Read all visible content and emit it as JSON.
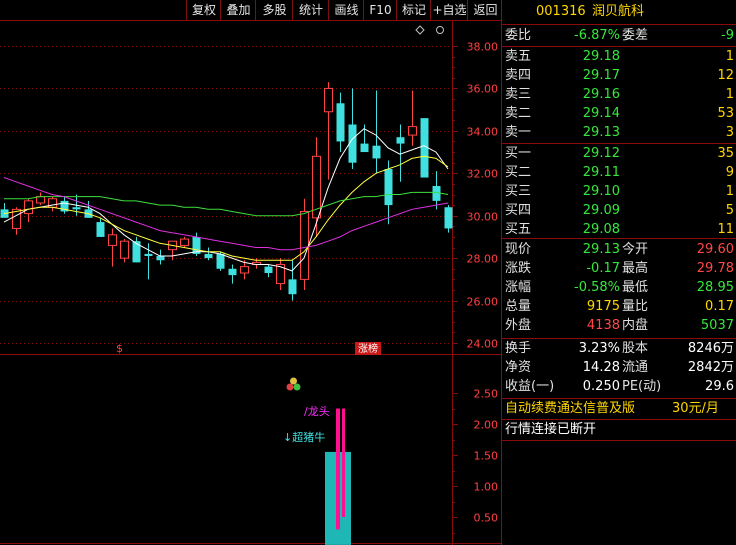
{
  "toolbar": {
    "items": [
      "复权",
      "叠加",
      "多股",
      "统计",
      "画线",
      "F10",
      "标记",
      "+自选",
      "返回"
    ]
  },
  "stock": {
    "code": "001316",
    "name": "润贝航科"
  },
  "order_book": {
    "weibi_label": "委比",
    "weibi_value": "-6.87%",
    "weicha_label": "委差",
    "weicha_value": "-9",
    "sells": [
      {
        "label": "卖五",
        "price": "29.18",
        "vol": "1"
      },
      {
        "label": "卖四",
        "price": "29.17",
        "vol": "12"
      },
      {
        "label": "卖三",
        "price": "29.16",
        "vol": "1"
      },
      {
        "label": "卖二",
        "price": "29.14",
        "vol": "53"
      },
      {
        "label": "卖一",
        "price": "29.13",
        "vol": "3"
      }
    ],
    "buys": [
      {
        "label": "买一",
        "price": "29.12",
        "vol": "35"
      },
      {
        "label": "买二",
        "price": "29.11",
        "vol": "9"
      },
      {
        "label": "买三",
        "price": "29.10",
        "vol": "1"
      },
      {
        "label": "买四",
        "price": "29.09",
        "vol": "5"
      },
      {
        "label": "买五",
        "price": "29.08",
        "vol": "11"
      }
    ]
  },
  "quote": {
    "rows": [
      {
        "l1": "现价",
        "v1": "29.13",
        "c1": "green",
        "l2": "今开",
        "v2": "29.60",
        "c2": "red"
      },
      {
        "l1": "涨跌",
        "v1": "-0.17",
        "c1": "green",
        "l2": "最高",
        "v2": "29.78",
        "c2": "red"
      },
      {
        "l1": "涨幅",
        "v1": "-0.58%",
        "c1": "green",
        "l2": "最低",
        "v2": "28.95",
        "c2": "green"
      },
      {
        "l1": "总量",
        "v1": "9175",
        "c1": "yellow",
        "l2": "量比",
        "v2": "0.17",
        "c2": "yellow"
      },
      {
        "l1": "外盘",
        "v1": "4138",
        "c1": "red",
        "l2": "内盘",
        "v2": "5037",
        "c2": "green"
      }
    ],
    "fund_rows": [
      {
        "l1": "换手",
        "v1": "3.23%",
        "l2": "股本",
        "v2": "8246万"
      },
      {
        "l1": "净资",
        "v1": "14.28",
        "l2": "流通",
        "v2": "2842万"
      },
      {
        "l1": "收益(一)",
        "v1": "0.250",
        "l2": "PE(动)",
        "v2": "29.6"
      }
    ]
  },
  "notices": {
    "ad_text": "自动续费通达信普及版",
    "ad_price": "30元/月",
    "status": "行情连接已断开"
  },
  "chart_data": {
    "type": "candlestick",
    "price_axis": {
      "ticks": [
        "38.00",
        "36.00",
        "34.00",
        "32.00",
        "30.00",
        "28.00",
        "26.00",
        "24.00"
      ],
      "ylim": [
        24,
        39.5
      ]
    },
    "candles": [
      {
        "o": 30.3,
        "h": 30.6,
        "l": 30.0,
        "c": 29.9
      },
      {
        "o": 29.4,
        "h": 30.4,
        "l": 29.1,
        "c": 30.3
      },
      {
        "o": 30.1,
        "h": 30.8,
        "l": 29.7,
        "c": 30.7
      },
      {
        "o": 30.6,
        "h": 31.1,
        "l": 30.5,
        "c": 30.9
      },
      {
        "o": 30.4,
        "h": 30.9,
        "l": 30.2,
        "c": 30.8
      },
      {
        "o": 30.7,
        "h": 30.9,
        "l": 30.1,
        "c": 30.2
      },
      {
        "o": 30.4,
        "h": 31.0,
        "l": 30.0,
        "c": 30.3
      },
      {
        "o": 30.3,
        "h": 30.7,
        "l": 29.9,
        "c": 29.9
      },
      {
        "o": 29.7,
        "h": 29.9,
        "l": 29.0,
        "c": 29.0
      },
      {
        "o": 28.6,
        "h": 29.4,
        "l": 27.6,
        "c": 29.1
      },
      {
        "o": 28.0,
        "h": 28.9,
        "l": 27.8,
        "c": 28.8
      },
      {
        "o": 28.8,
        "h": 29.0,
        "l": 27.8,
        "c": 27.8
      },
      {
        "o": 28.2,
        "h": 28.7,
        "l": 27.0,
        "c": 28.1
      },
      {
        "o": 28.1,
        "h": 28.4,
        "l": 27.7,
        "c": 27.9
      },
      {
        "o": 28.4,
        "h": 28.8,
        "l": 27.9,
        "c": 28.8
      },
      {
        "o": 28.6,
        "h": 29.0,
        "l": 28.5,
        "c": 28.9
      },
      {
        "o": 29.0,
        "h": 29.2,
        "l": 28.1,
        "c": 28.2
      },
      {
        "o": 28.2,
        "h": 28.5,
        "l": 27.9,
        "c": 28.0
      },
      {
        "o": 28.2,
        "h": 28.3,
        "l": 27.4,
        "c": 27.5
      },
      {
        "o": 27.5,
        "h": 27.7,
        "l": 26.8,
        "c": 27.2
      },
      {
        "o": 27.3,
        "h": 27.9,
        "l": 27.0,
        "c": 27.6
      },
      {
        "o": 27.7,
        "h": 28.0,
        "l": 27.5,
        "c": 27.8
      },
      {
        "o": 27.6,
        "h": 27.7,
        "l": 27.1,
        "c": 27.3
      },
      {
        "o": 26.8,
        "h": 28.0,
        "l": 26.5,
        "c": 27.7
      },
      {
        "o": 27.0,
        "h": 27.9,
        "l": 26.0,
        "c": 26.3
      },
      {
        "o": 27.0,
        "h": 30.8,
        "l": 26.5,
        "c": 30.2
      },
      {
        "o": 29.9,
        "h": 33.7,
        "l": 29.0,
        "c": 32.8
      },
      {
        "o": 34.9,
        "h": 36.3,
        "l": 31.7,
        "c": 36.0
      },
      {
        "o": 35.3,
        "h": 35.8,
        "l": 33.0,
        "c": 33.5
      },
      {
        "o": 34.3,
        "h": 36.0,
        "l": 32.2,
        "c": 32.5
      },
      {
        "o": 33.4,
        "h": 34.3,
        "l": 33.1,
        "c": 33.0
      },
      {
        "o": 33.3,
        "h": 35.9,
        "l": 32.0,
        "c": 32.7
      },
      {
        "o": 32.2,
        "h": 32.6,
        "l": 29.6,
        "c": 30.5
      },
      {
        "o": 33.7,
        "h": 34.3,
        "l": 31.6,
        "c": 33.4
      },
      {
        "o": 33.8,
        "h": 35.9,
        "l": 33.3,
        "c": 34.2
      },
      {
        "o": 34.6,
        "h": 34.5,
        "l": 31.8,
        "c": 31.8
      },
      {
        "o": 31.4,
        "h": 32.1,
        "l": 30.3,
        "c": 30.7
      },
      {
        "o": 30.4,
        "h": 30.5,
        "l": 29.2,
        "c": 29.4
      }
    ],
    "ma_lines": [
      {
        "color": "#ffffff",
        "values": [
          29.7,
          30.0,
          30.3,
          30.4,
          30.5,
          30.6,
          30.5,
          30.4,
          30.1,
          29.6,
          29.1,
          28.7,
          28.4,
          28.1,
          28.1,
          28.2,
          28.3,
          28.3,
          28.2,
          28.0,
          27.8,
          27.7,
          27.7,
          27.6,
          27.4,
          28.0,
          29.6,
          31.3,
          32.7,
          33.6,
          34.1,
          33.8,
          33.2,
          32.9,
          33.1,
          33.3,
          33.0,
          32.2
        ]
      },
      {
        "color": "#ffff40",
        "values": [
          30.1,
          30.2,
          30.3,
          30.4,
          30.4,
          30.3,
          30.2,
          30.1,
          29.9,
          29.6,
          29.3,
          29.1,
          28.9,
          28.7,
          28.6,
          28.5,
          28.4,
          28.3,
          28.3,
          28.1,
          28.0,
          27.9,
          27.9,
          27.9,
          27.9,
          28.3,
          29.0,
          29.8,
          30.5,
          31.1,
          31.6,
          32.0,
          32.2,
          32.4,
          32.7,
          32.8,
          32.7,
          32.3
        ]
      },
      {
        "color": "#3ce03c",
        "values": [
          30.8,
          30.8,
          30.8,
          30.9,
          30.9,
          30.9,
          30.9,
          30.9,
          30.9,
          30.8,
          30.7,
          30.7,
          30.6,
          30.5,
          30.5,
          30.4,
          30.4,
          30.3,
          30.3,
          30.2,
          30.1,
          30.0,
          30.0,
          30.0,
          30.0,
          30.1,
          30.3,
          30.5,
          30.7,
          30.8,
          30.9,
          30.9,
          31.0,
          31.0,
          31.1,
          31.1,
          31.1,
          31.0
        ]
      },
      {
        "color": "#e030e0",
        "values": [
          31.8,
          31.6,
          31.4,
          31.2,
          31.0,
          30.9,
          30.7,
          30.5,
          30.3,
          30.1,
          29.9,
          29.7,
          29.5,
          29.3,
          29.2,
          29.1,
          29.0,
          28.9,
          28.8,
          28.7,
          28.6,
          28.5,
          28.5,
          28.4,
          28.4,
          28.5,
          28.6,
          28.8,
          29.0,
          29.3,
          29.5,
          29.7,
          29.9,
          30.1,
          30.3,
          30.4,
          30.5,
          30.6
        ]
      }
    ],
    "markers": {
      "s_label": "$",
      "zhangbang_label": "涨榜"
    },
    "indicator": {
      "axis_ticks": [
        "2.50",
        "2.00",
        "1.50",
        "1.00",
        "0.50"
      ],
      "ylim": [
        0,
        2.75
      ],
      "bars": [
        {
          "index": 27,
          "value": 1.55
        }
      ],
      "signals": [
        {
          "index": 27,
          "top": 2.25,
          "bottom": 0.3
        }
      ],
      "labels": {
        "longtou": "龙头",
        "chaozhu": "超猪牛"
      }
    }
  }
}
